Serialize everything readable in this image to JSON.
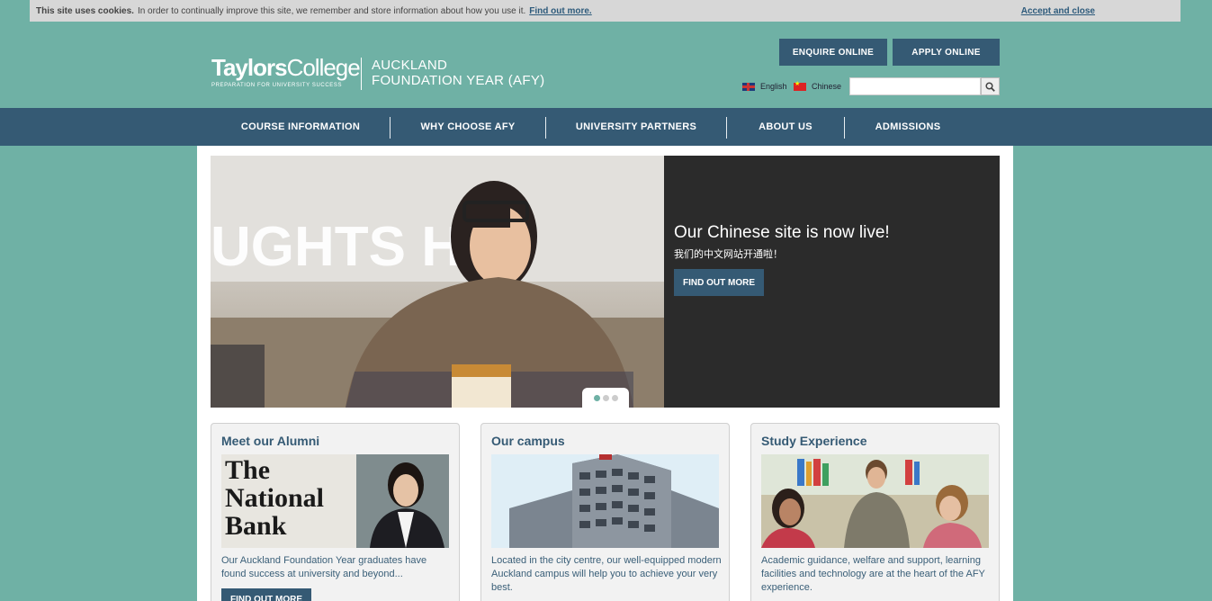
{
  "cookie": {
    "bold": "This site uses cookies.",
    "text": "In order to continually improve this site, we remember and store information about how you use it.",
    "find_out": "Find out more.",
    "accept": "Accept and close"
  },
  "logo": {
    "brand_bold": "Taylors",
    "brand_light": "College",
    "tagline": "PREPARATION FOR UNIVERSITY SUCCESS",
    "sub_line1": "AUCKLAND",
    "sub_line2": "FOUNDATION YEAR (AFY)"
  },
  "header": {
    "enquire": "ENQUIRE ONLINE",
    "apply": "APPLY ONLINE",
    "lang_en": "English",
    "lang_cn": "Chinese",
    "search_placeholder": ""
  },
  "nav": {
    "items": [
      "COURSE INFORMATION",
      "WHY CHOOSE AFY",
      "UNIVERSITY PARTNERS",
      "ABOUT US",
      "ADMISSIONS"
    ]
  },
  "hero": {
    "title": "Our Chinese site is now live!",
    "subtitle": "我们的中文网站开通啦！",
    "button": "FIND OUT MORE",
    "image_text": "UGHTS HAT"
  },
  "cards": [
    {
      "title": "Meet our Alumni",
      "image_text": "The National Bank",
      "text": "Our Auckland Foundation Year graduates have found success at university and beyond...",
      "button": "FIND OUT MORE"
    },
    {
      "title": "Our campus",
      "text": "Located in the city centre, our well-equipped modern Auckland campus will help you to achieve your very best."
    },
    {
      "title": "Study Experience",
      "text": "Academic guidance, welfare and support, learning facilities and technology are at the heart of the AFY experience."
    }
  ]
}
